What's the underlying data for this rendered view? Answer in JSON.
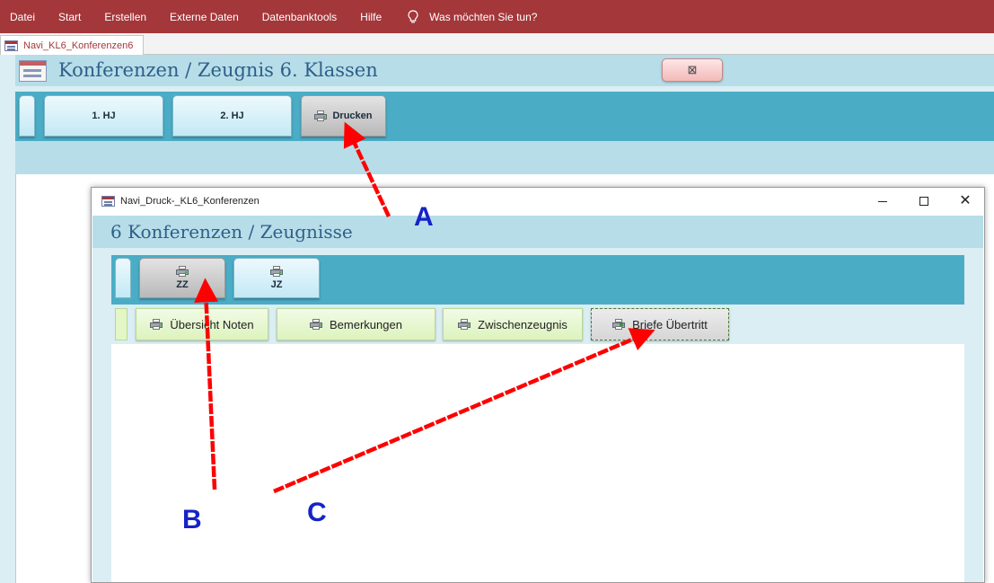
{
  "menubar": {
    "items": [
      "Datei",
      "Start",
      "Erstellen",
      "Externe Daten",
      "Datenbanktools",
      "Hilfe"
    ],
    "tell_me": "Was möchten Sie tun?"
  },
  "doc_tab": {
    "label": "Navi_KL6_Konferenzen6"
  },
  "main_form": {
    "title": "Konferenzen / Zeugnis 6. Klassen",
    "close_glyph": "⊠",
    "nav": [
      "1. HJ",
      "2. HJ",
      "Drucken"
    ]
  },
  "popup": {
    "window_title": "Navi_Druck-_KL6_Konferenzen",
    "controls": {
      "minimize": "—",
      "maximize": "☐",
      "close": "✕"
    },
    "heading": "6 Konferenzen / Zeugnisse",
    "tabs": [
      "ZZ",
      "JZ"
    ],
    "actions": [
      "Übersicht Noten",
      "Bemerkungen",
      "Zwischenzeugnis",
      "Briefe Übertritt"
    ]
  },
  "annotations": {
    "labels": [
      "A",
      "B",
      "C"
    ],
    "arrow_color": "#ff0000",
    "label_color": "#1523c7"
  },
  "colors": {
    "ribbon": "#a4373a",
    "header_band": "#b7dde8",
    "nav_band": "#4bacc6",
    "form_background": "#dbeef3",
    "title_text": "#2e5f8a",
    "action_button": "#dcf3bd"
  },
  "icons": {
    "menu_bulb": "lightbulb-icon",
    "doc_tab": "form-icon",
    "print_button": "printer-icon",
    "briefe_button": "printer-check-icon"
  }
}
